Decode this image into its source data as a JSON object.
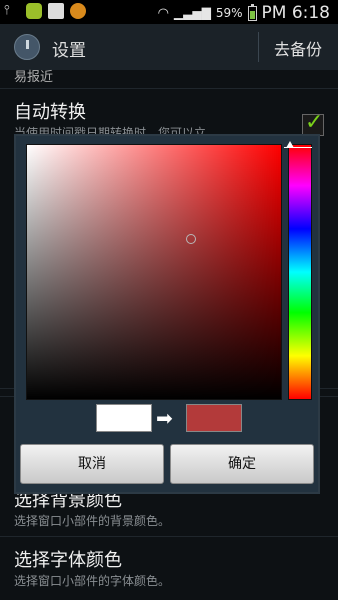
{
  "status_bar": {
    "battery_percent": "59%",
    "time": "PM 6:18",
    "icons": [
      "usb-icon",
      "chat-icon",
      "gallery-icon",
      "app-icon",
      "wifi-icon",
      "signal-icon",
      "battery-icon"
    ]
  },
  "action_bar": {
    "title": "设置",
    "action_label": "去备份"
  },
  "list": {
    "section_header_partial": "易报近",
    "auto_switch": {
      "title": "自动转换",
      "subtitle_partial": "当使用时间戳日期转换时，您可以立"
    },
    "bg_color": {
      "title": "选择背景颜色",
      "subtitle": "选择窗口小部件的背景颜色。"
    },
    "font_color": {
      "title": "选择字体颜色",
      "subtitle": "选择窗口小部件的字体颜色。"
    }
  },
  "dialog": {
    "cancel_label": "取消",
    "ok_label": "确定",
    "old_color": "#ffffff",
    "new_color": "#b33a3a",
    "arrow_glyph": "➡"
  }
}
